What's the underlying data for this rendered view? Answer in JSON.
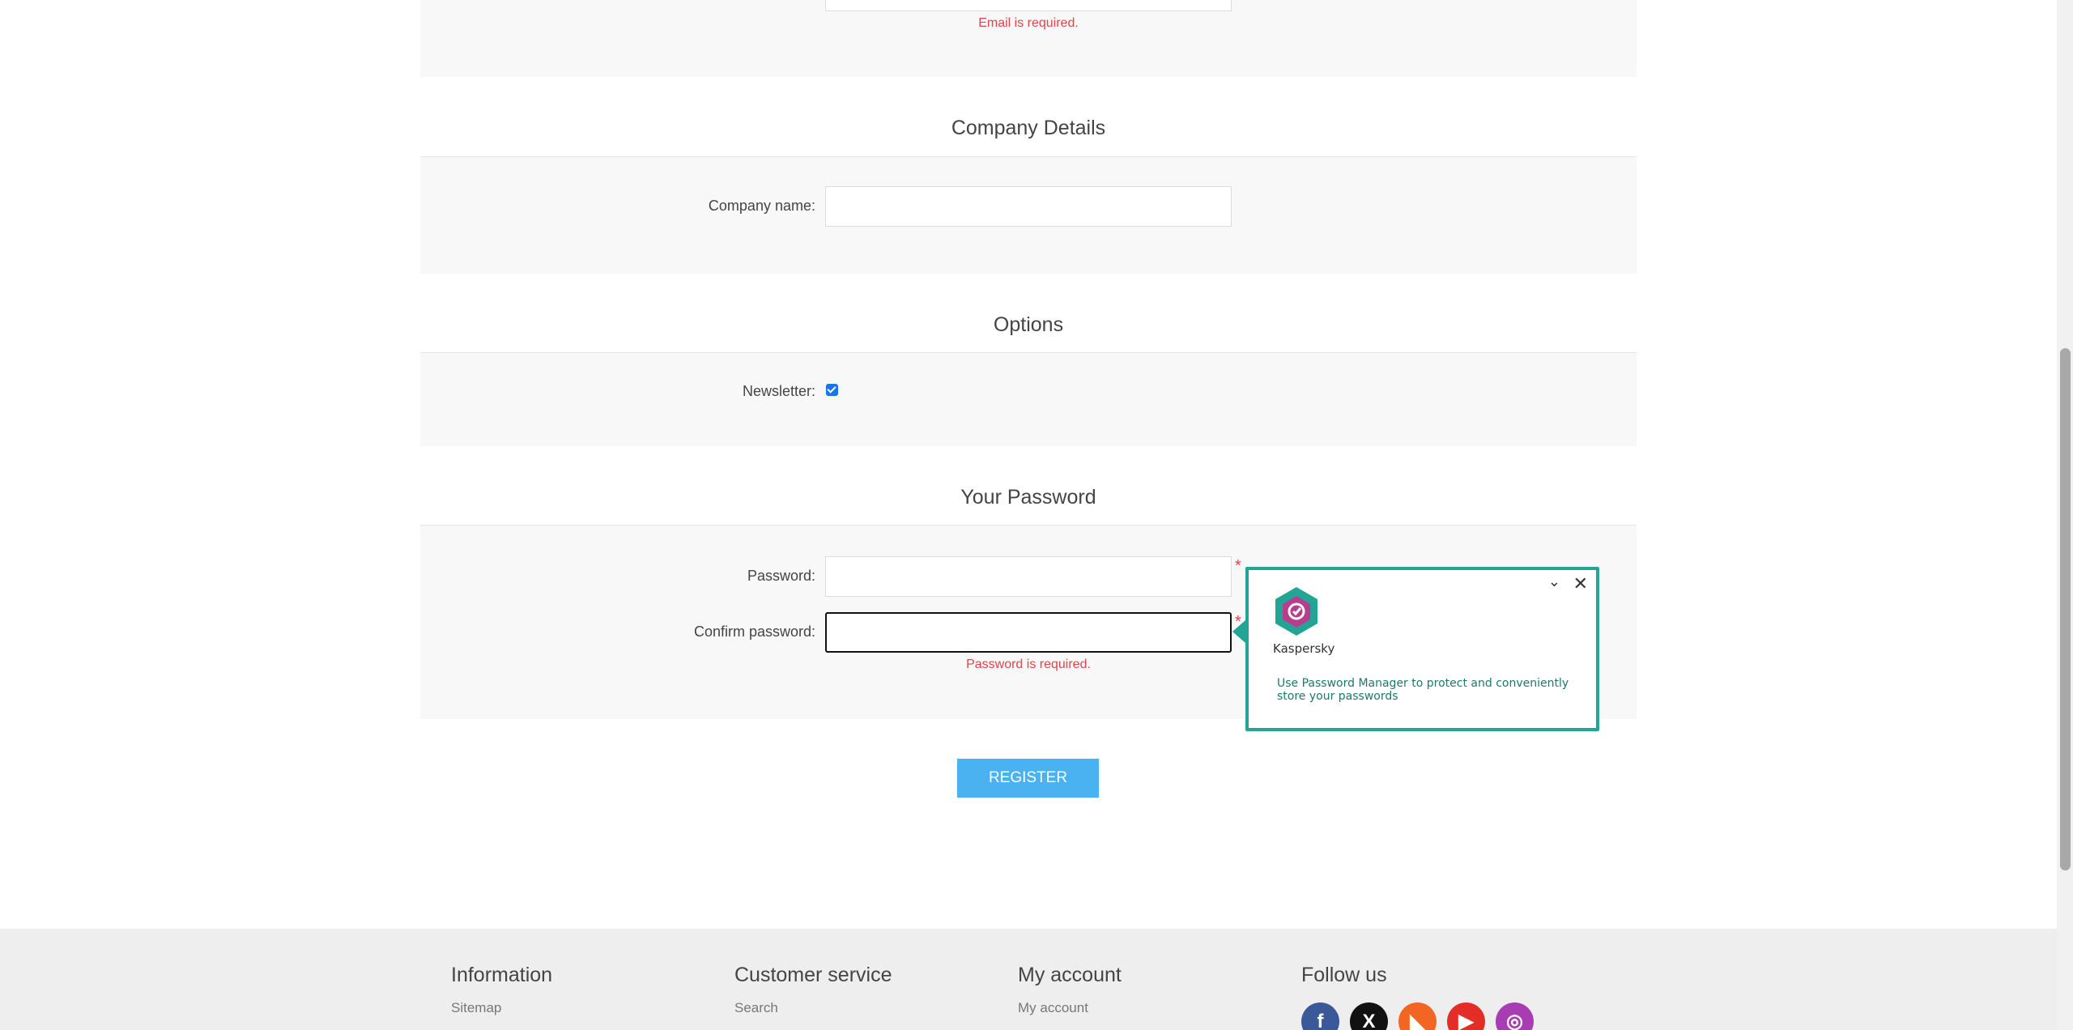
{
  "email_section": {
    "error": "Email is required."
  },
  "company_section": {
    "title": "Company Details",
    "company_label": "Company name:",
    "company_value": ""
  },
  "options_section": {
    "title": "Options",
    "newsletter_label": "Newsletter:",
    "newsletter_checked": true
  },
  "password_section": {
    "title": "Your Password",
    "password_label": "Password:",
    "confirm_label": "Confirm password:",
    "required_mark": "*",
    "error": "Password is required."
  },
  "register_button": "Register",
  "kaspersky_popup": {
    "name": "Kaspersky",
    "message": "Use Password Manager to protect and conveniently store your passwords",
    "close_icon": "close-icon",
    "collapse_icon": "chevron-down-icon",
    "accent": "#23a596"
  },
  "footer": {
    "information": {
      "title": "Information",
      "link": "Sitemap"
    },
    "customer_service": {
      "title": "Customer service",
      "link": "Search"
    },
    "my_account": {
      "title": "My account",
      "link": "My account"
    },
    "follow_us": {
      "title": "Follow us"
    },
    "social": [
      {
        "name": "facebook",
        "glyph": "f",
        "color": "#3b5998"
      },
      {
        "name": "x",
        "glyph": "X",
        "color": "#111111"
      },
      {
        "name": "rss",
        "glyph": "◣",
        "color": "#f26522"
      },
      {
        "name": "youtube",
        "glyph": "▶",
        "color": "#e52d27"
      },
      {
        "name": "instagram",
        "glyph": "◎",
        "color": "#a83cb3"
      }
    ]
  },
  "colors": {
    "error": "#e4434b",
    "button": "#4ab2f1",
    "section_bg": "#f8f8f8",
    "footer_bg": "#eeeeee"
  }
}
